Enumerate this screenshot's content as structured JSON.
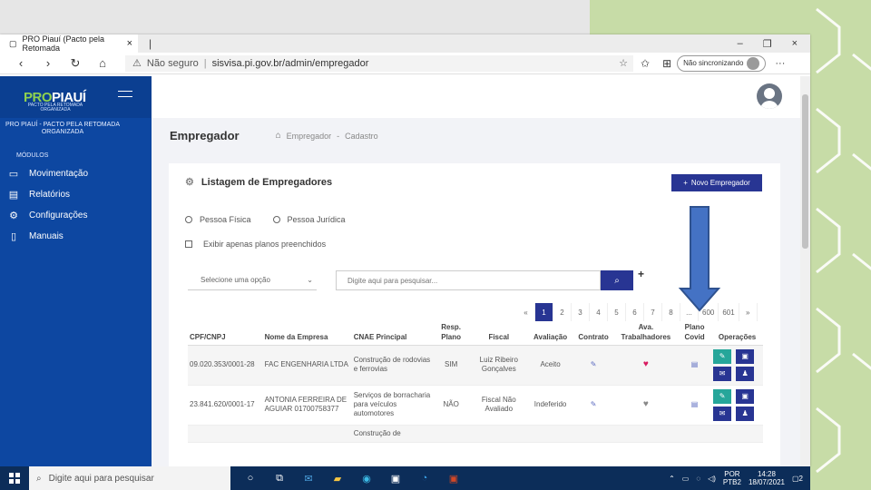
{
  "browser": {
    "tab_title": "PRO Piauí (Pacto pela Retomada",
    "tab_close": "×",
    "tab_new": "|",
    "security": "Não seguro",
    "url": "sisvisa.pi.gov.br/admin/empregador",
    "sync_label": "Não sincronizando",
    "more": "···",
    "minimize": "–",
    "restore": "❐",
    "close": "×"
  },
  "sidebar": {
    "brand_pro": "PRO",
    "brand_piaui": "PIAUÍ",
    "brand_sub": "PACTO PELA RETOMADA ORGANIZADA",
    "org_name": "PRO PIAUÍ - PACTO PELA RETOMADA ORGANIZADA",
    "section": "MÓDULOS",
    "items": [
      {
        "label": "Movimentação",
        "icon": "monitor-icon"
      },
      {
        "label": "Relatórios",
        "icon": "report-icon"
      },
      {
        "label": "Configurações",
        "icon": "gear-icon"
      },
      {
        "label": "Manuais",
        "icon": "book-icon"
      }
    ]
  },
  "page": {
    "title": "Empregador",
    "breadcrumb": [
      "Empregador",
      "Cadastro"
    ],
    "breadcrumb_sep": "-"
  },
  "card": {
    "title": "Listagem de Empregadores",
    "new_button": "Novo Empregador",
    "radio_1": "Pessoa Física",
    "radio_2": "Pessoa Jurídica",
    "checkbox": "Exibir apenas planos preenchidos",
    "select_placeholder": "Selecione uma opção",
    "search_placeholder": "Digite aqui para pesquisar...",
    "plus": "+"
  },
  "pager": [
    "«",
    "1",
    "2",
    "3",
    "4",
    "5",
    "6",
    "7",
    "8",
    "...",
    "600",
    "601",
    "»"
  ],
  "table": {
    "headers": [
      "CPF/CNPJ",
      "Nome da Empresa",
      "CNAE Principal",
      "Resp. Plano",
      "Fiscal",
      "Avaliação",
      "Contrato",
      "Ava. Trabalhadores",
      "Plano Covid",
      "Operações"
    ],
    "rows": [
      {
        "cpf": "09.020.353/0001-28",
        "nome": "FAC ENGENHARIA LTDA",
        "cnae": "Construção de rodovias e ferrovias",
        "resp": "SIM",
        "fiscal": "Luiz Ribeiro Gonçalves",
        "avaliacao": "Aceito"
      },
      {
        "cpf": "23.841.620/0001-17",
        "nome": "ANTONIA FERREIRA DE AGUIAR 01700758377",
        "cnae": "Serviços de borracharia para veículos automotores",
        "resp": "NÃO",
        "fiscal": "Fiscal Não Avaliado",
        "avaliacao": "Indeferido"
      },
      {
        "cpf": "",
        "nome": "",
        "cnae": "Construção de",
        "resp": "",
        "fiscal": "",
        "avaliacao": ""
      }
    ]
  },
  "taskbar": {
    "search": "Digite aqui para pesquisar",
    "lang_1": "POR",
    "lang_2": "PTB2",
    "time": "14:28",
    "date": "18/07/2021",
    "notif": "2"
  },
  "colors": {
    "sidebar": "#0d47a1",
    "primary": "#283593",
    "green_btn": "#26a69a",
    "slide_bg": "#c7dca7"
  }
}
